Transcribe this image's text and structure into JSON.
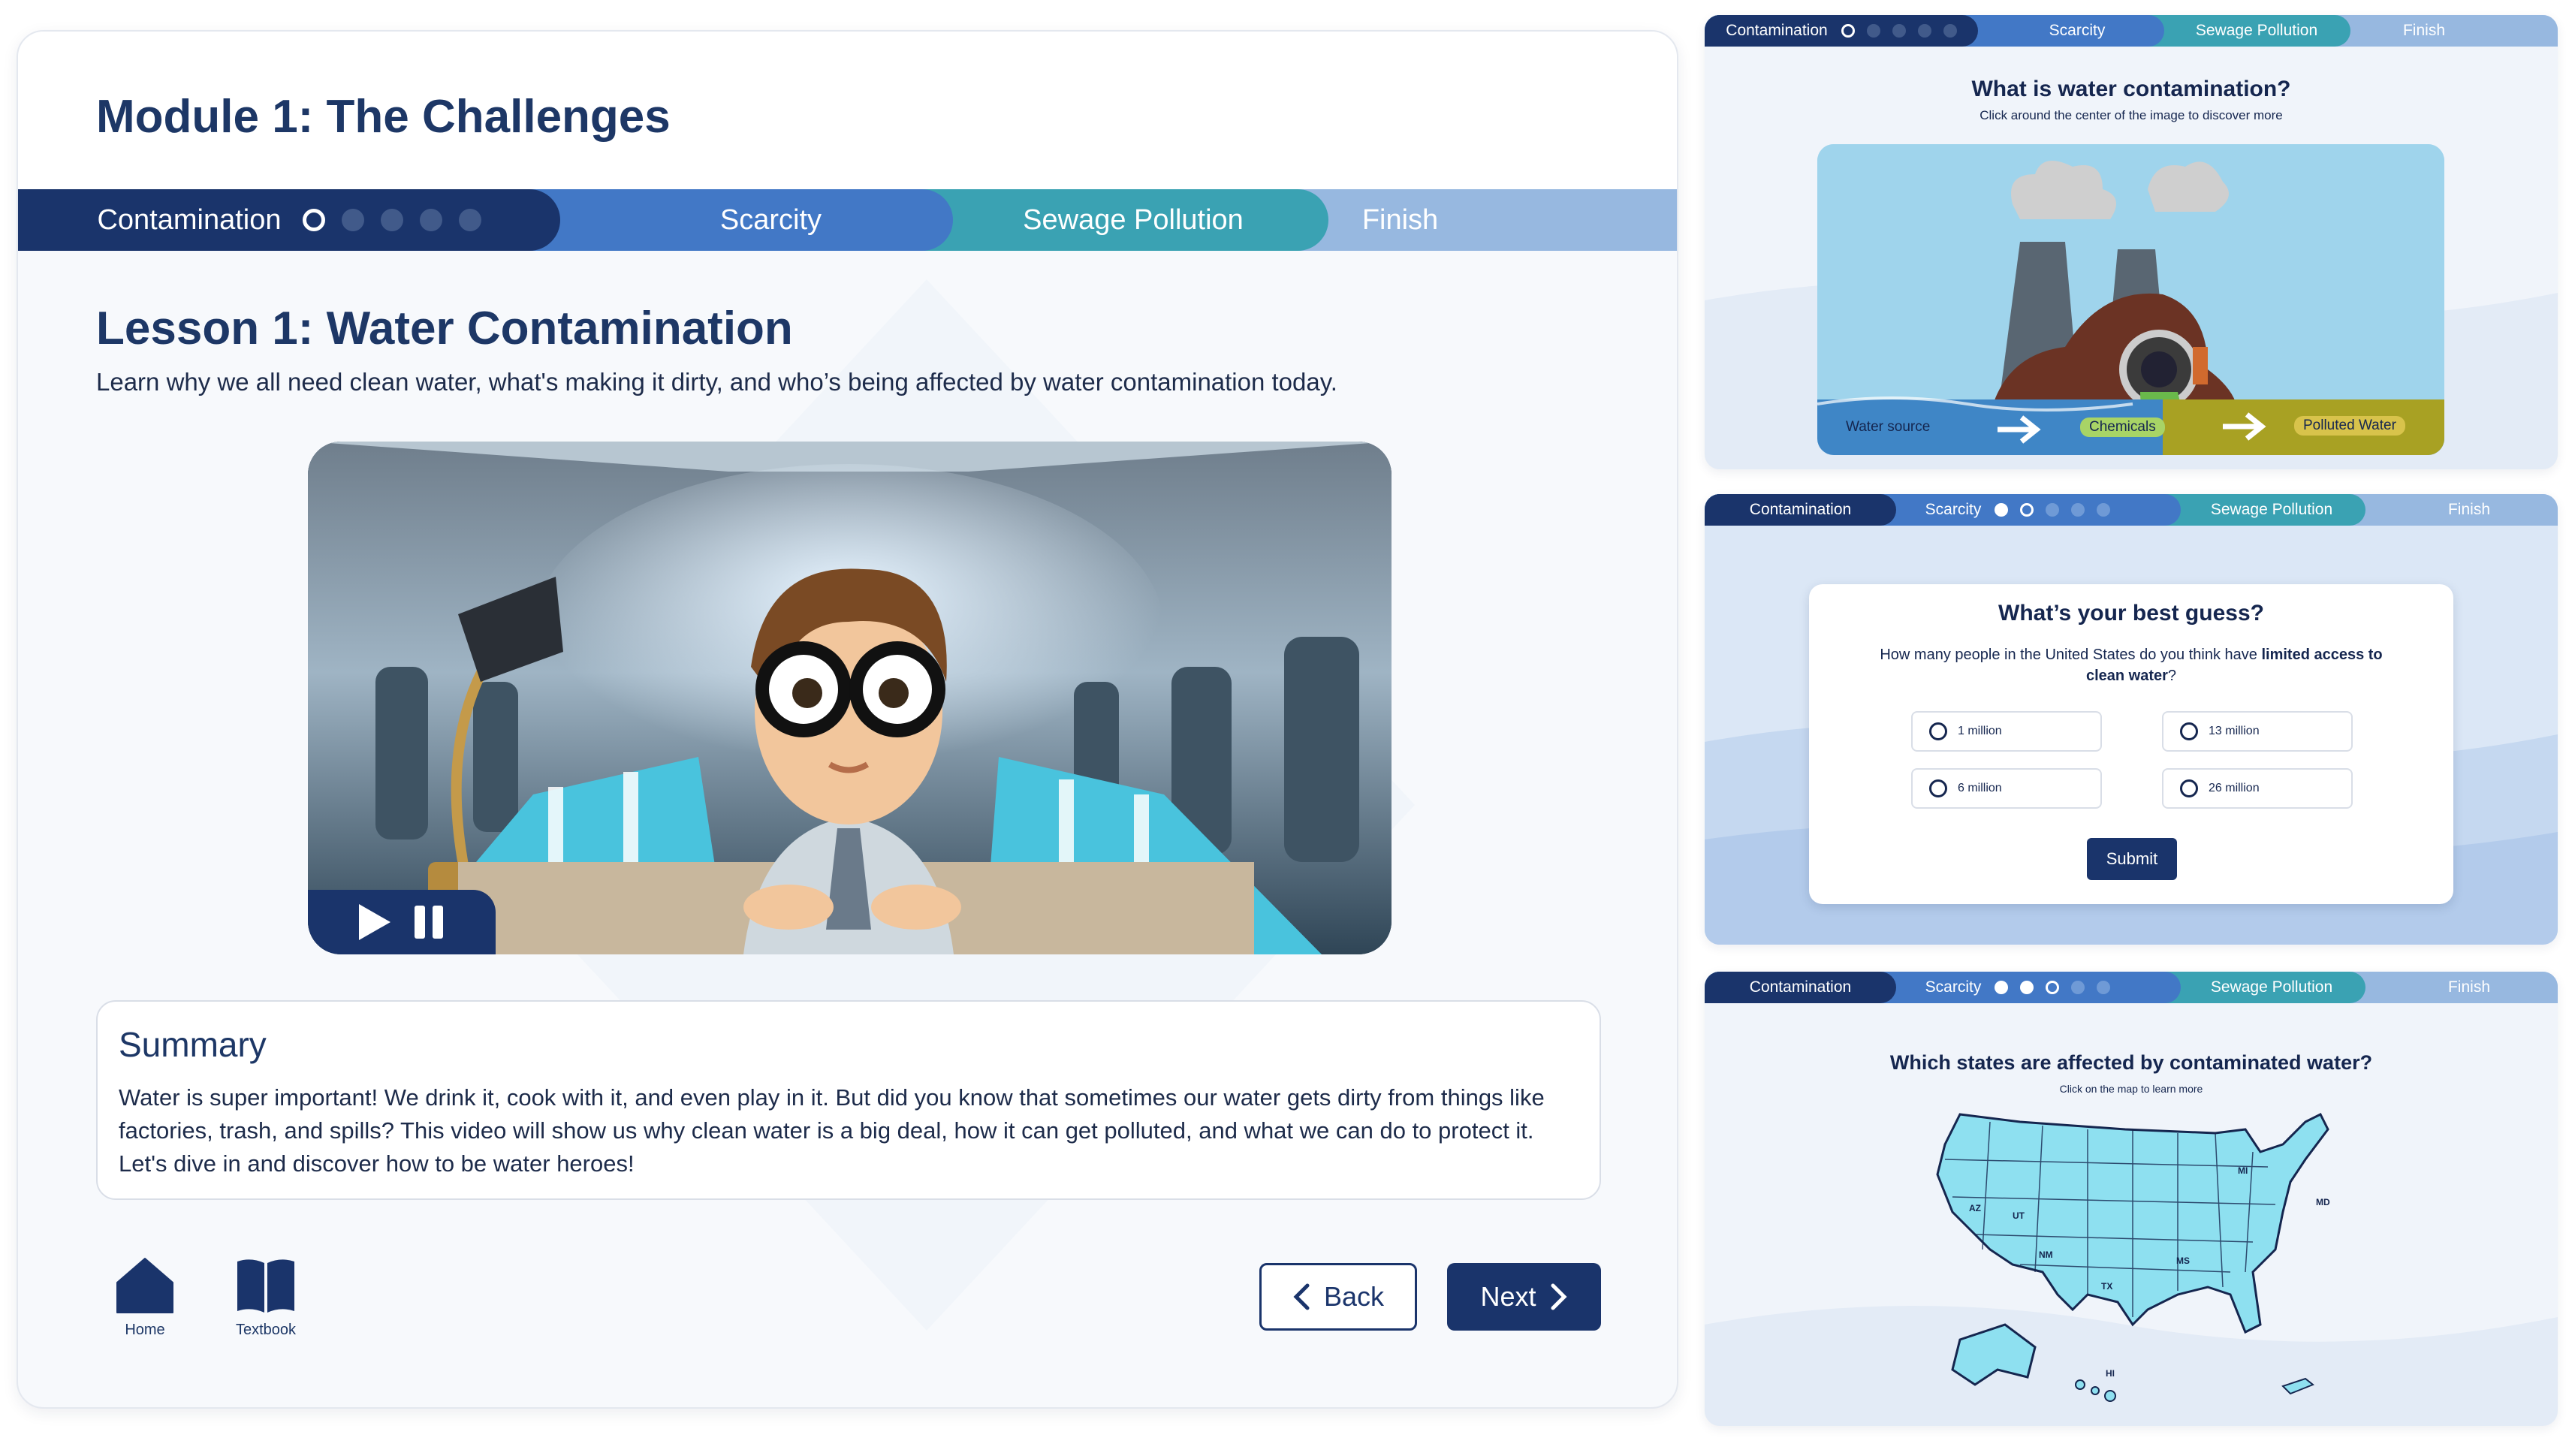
{
  "main": {
    "module_title": "Module 1: The Challenges",
    "tabs": [
      "Contamination",
      "Scarcity",
      "Sewage Pollution",
      "Finish"
    ],
    "lesson_title": "Lesson 1: Water Contamination",
    "lesson_subtitle": "Learn why we all need clean water, what's making it dirty, and who’s being affected by water contamination today.",
    "summary_title": "Summary",
    "summary_text": "Water is super important! We drink it, cook with it, and even play in it. But did you know that sometimes our water gets dirty from things like factories, trash, and spills? This video will show us why clean water is a big deal, how it can get polluted, and what we can do to protect it. Let's dive in and discover how to be water heroes!",
    "home_label": "Home",
    "textbook_label": "Textbook",
    "back_label": "Back",
    "next_label": "Next"
  },
  "panel1": {
    "tabs": [
      "Contamination",
      "Scarcity",
      "Sewage Pollution",
      "Finish"
    ],
    "title": "What is water contamination?",
    "subtitle": "Click around the center of the image to discover more",
    "labels": [
      "Water source",
      "Chemicals",
      "Polluted Water"
    ]
  },
  "panel2": {
    "tabs": [
      "Contamination",
      "Scarcity",
      "Sewage Pollution",
      "Finish"
    ],
    "title": "What’s your best guess?",
    "question_start": "How many people in the United States do you think have ",
    "question_bold": "limited access to clean water",
    "question_end": "?",
    "options": [
      "1 million",
      "13 million",
      "6 million",
      "26 million"
    ],
    "submit_label": "Submit"
  },
  "panel3": {
    "tabs": [
      "Contamination",
      "Scarcity",
      "Sewage Pollution",
      "Finish"
    ],
    "title": "Which states are affected by contaminated water?",
    "subtitle": "Click on the map to learn more",
    "states": [
      "MI",
      "MD",
      "AZ",
      "UT",
      "NM",
      "TX",
      "MS",
      "HI"
    ]
  },
  "colors": {
    "navy": "#1a346b",
    "blue": "#4278c6",
    "teal": "#3aa2b3",
    "light_blue": "#97b8e0",
    "map_fill": "#8ee0f0"
  }
}
